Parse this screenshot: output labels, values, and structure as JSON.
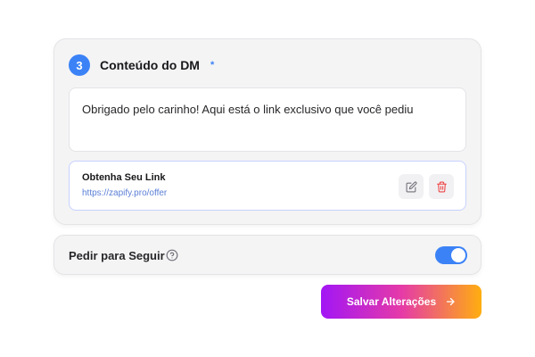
{
  "dm_section": {
    "step_number": "3",
    "title": "Conteúdo do DM",
    "required_marker": "*",
    "message": "Obrigado pelo carinho! Aqui está o link exclusivo que você pediu",
    "link": {
      "title": "Obtenha Seu Link",
      "url": "https://zapify.pro/offer"
    }
  },
  "follow_section": {
    "label": "Pedir para Seguir",
    "toggle_on": true
  },
  "actions": {
    "save_label": "Salvar Alterações"
  },
  "colors": {
    "accent": "#3b82f6",
    "delete": "#ef4444",
    "gradient": [
      "#a216f5",
      "#e53aa8",
      "#ffae10"
    ]
  }
}
